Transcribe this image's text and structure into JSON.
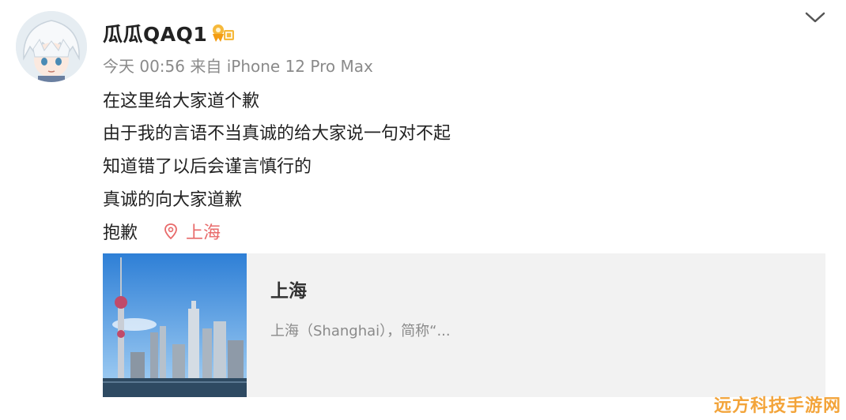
{
  "post": {
    "username": "瓜瓜QAQ1",
    "meta": "今天 00:56 来自 iPhone 12 Pro Max",
    "lines": [
      "在这里给大家道个歉",
      "由于我的言语不当真诚的给大家说一句对不起",
      "知道错了以后会谨言慎行的",
      "真诚的向大家道歉",
      "抱歉"
    ],
    "location": "上海",
    "icons": {
      "badge": "vip-badge-icon",
      "more": "chevron-down-icon",
      "location": "location-pin-icon"
    }
  },
  "card": {
    "title": "上海",
    "description": "上海（Shanghai），简称“..."
  },
  "watermark": "远方科技手游网",
  "colors": {
    "location": "#e86a6a",
    "watermark": "#f3a43a",
    "card_bg": "#f2f2f2"
  }
}
